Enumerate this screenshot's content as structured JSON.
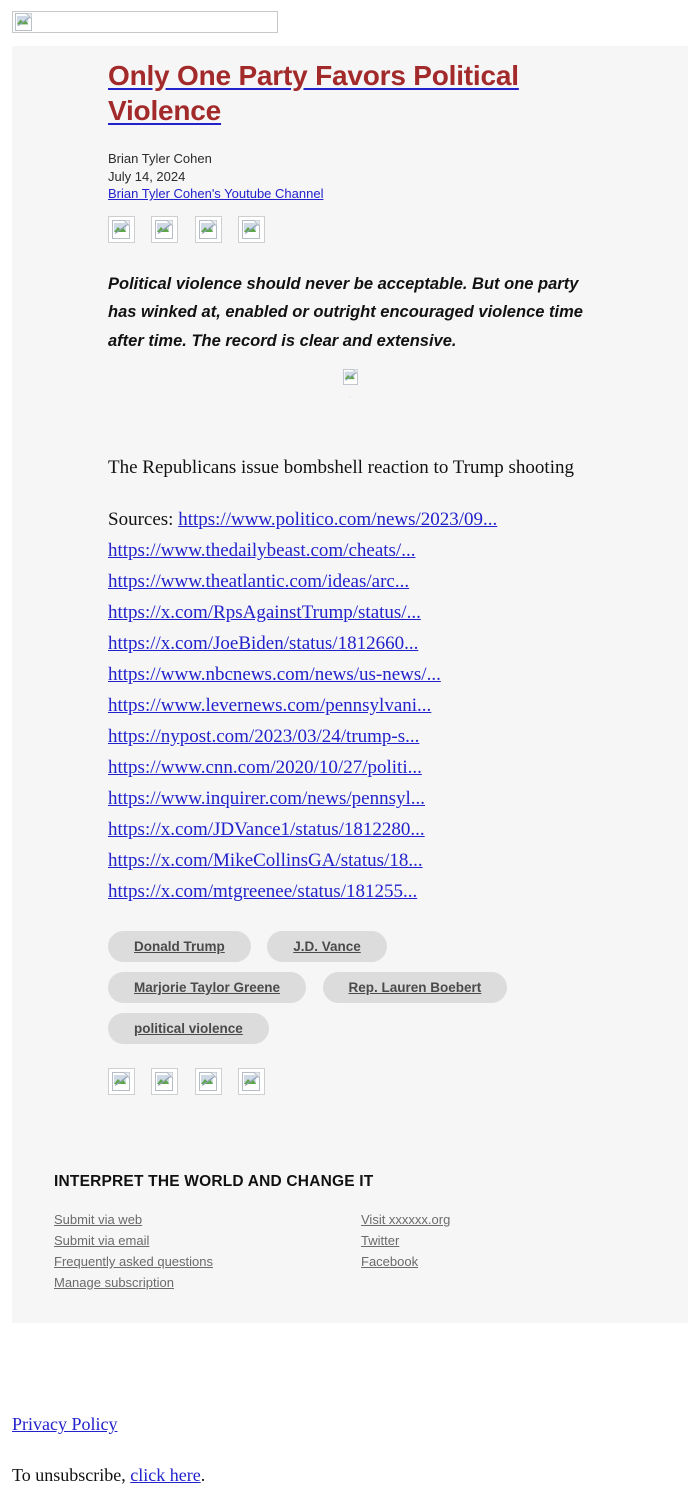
{
  "banner": {
    "image_alt_icon": "broken-image-icon"
  },
  "article": {
    "title": "Only One Party Favors Political Violence",
    "author": "Brian Tyler Cohen",
    "date": "July 14, 2024",
    "source_link": "Brian Tyler Cohen's Youtube Channel",
    "lede": "Political violence should never be acceptable. But one party has winked at, enabled or outright encouraged violence time after time. The record is clear and extensive.",
    "hero_caption": ",",
    "body_heading": "The Republicans issue bombshell reaction to Trump shooting",
    "title_color": "#a32a2a",
    "link_color": "#2222cc"
  },
  "sources": {
    "label": "Sources:",
    "links": [
      "https://www.politico.com/news/2023/09...",
      "https://www.thedailybeast.com/cheats/...",
      "https://www.theatlantic.com/ideas/arc...",
      "https://x.com/RpsAgainstTrump/status/...",
      "https://x.com/JoeBiden/status/1812660...",
      "https://www.nbcnews.com/news/us-news/...",
      "https://www.levernews.com/pennsylvani...",
      "https://nypost.com/2023/03/24/trump-s...",
      "https://www.cnn.com/2020/10/27/politi...",
      "https://www.inquirer.com/news/pennsyl...",
      "https://x.com/JDVance1/status/1812280...",
      "https://x.com/MikeCollinsGA/status/18...",
      "https://x.com/mtgreenee/status/181255..."
    ]
  },
  "tags": [
    "Donald Trump",
    "J.D. Vance",
    "Marjorie Taylor Greene",
    "Rep. Lauren Boebert",
    "political violence"
  ],
  "share_icons_top": [
    "broken-image-icon",
    "broken-image-icon",
    "broken-image-icon",
    "broken-image-icon"
  ],
  "share_icons_bottom": [
    "broken-image-icon",
    "broken-image-icon",
    "broken-image-icon",
    "broken-image-icon"
  ],
  "newsletter_footer": {
    "title": "INTERPRET THE WORLD AND CHANGE IT",
    "column_left": [
      "Submit via web",
      "Submit via email",
      "Frequently asked questions",
      "Manage subscription"
    ],
    "column_right": [
      "Visit xxxxxx.org",
      "Twitter",
      "Facebook"
    ]
  },
  "bottom": {
    "privacy": "Privacy Policy",
    "unsubscribe_prefix": "To unsubscribe, ",
    "unsubscribe_link": "click here",
    "unsubscribe_suffix": "."
  }
}
